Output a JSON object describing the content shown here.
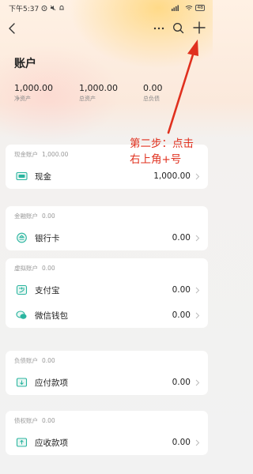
{
  "status_bar": {
    "time": "下午5:37",
    "battery": "48"
  },
  "page": {
    "title": "账户"
  },
  "summary": [
    {
      "value": "1,000.00",
      "label": "净资产"
    },
    {
      "value": "1,000.00",
      "label": "总资产"
    },
    {
      "value": "0.00",
      "label": "总负债"
    }
  ],
  "sections": [
    {
      "name": "现金账户",
      "amount": "1,000.00",
      "items": [
        {
          "name": "现金",
          "value": "1,000.00",
          "icon": "cash-icon"
        }
      ]
    },
    {
      "name": "金融账户",
      "amount": "0.00",
      "items": [
        {
          "name": "银行卡",
          "value": "0.00",
          "icon": "bank-card-icon"
        }
      ]
    },
    {
      "name": "虚拟账户",
      "amount": "0.00",
      "items": [
        {
          "name": "支付宝",
          "value": "0.00",
          "icon": "alipay-icon"
        },
        {
          "name": "微信钱包",
          "value": "0.00",
          "icon": "wechat-wallet-icon"
        }
      ]
    },
    {
      "name": "负债账户",
      "amount": "0.00",
      "items": [
        {
          "name": "应付款项",
          "value": "0.00",
          "icon": "payable-icon"
        }
      ]
    },
    {
      "name": "债权账户",
      "amount": "0.00",
      "items": [
        {
          "name": "应收款项",
          "value": "0.00",
          "icon": "receivable-icon"
        }
      ]
    }
  ],
  "annotation": {
    "line1": "第二步：点击",
    "line2": "右上角+号",
    "color": "#e0301e"
  },
  "colors": {
    "accent_teal": "#2bb5a0",
    "annotation_red": "#e0301e"
  }
}
